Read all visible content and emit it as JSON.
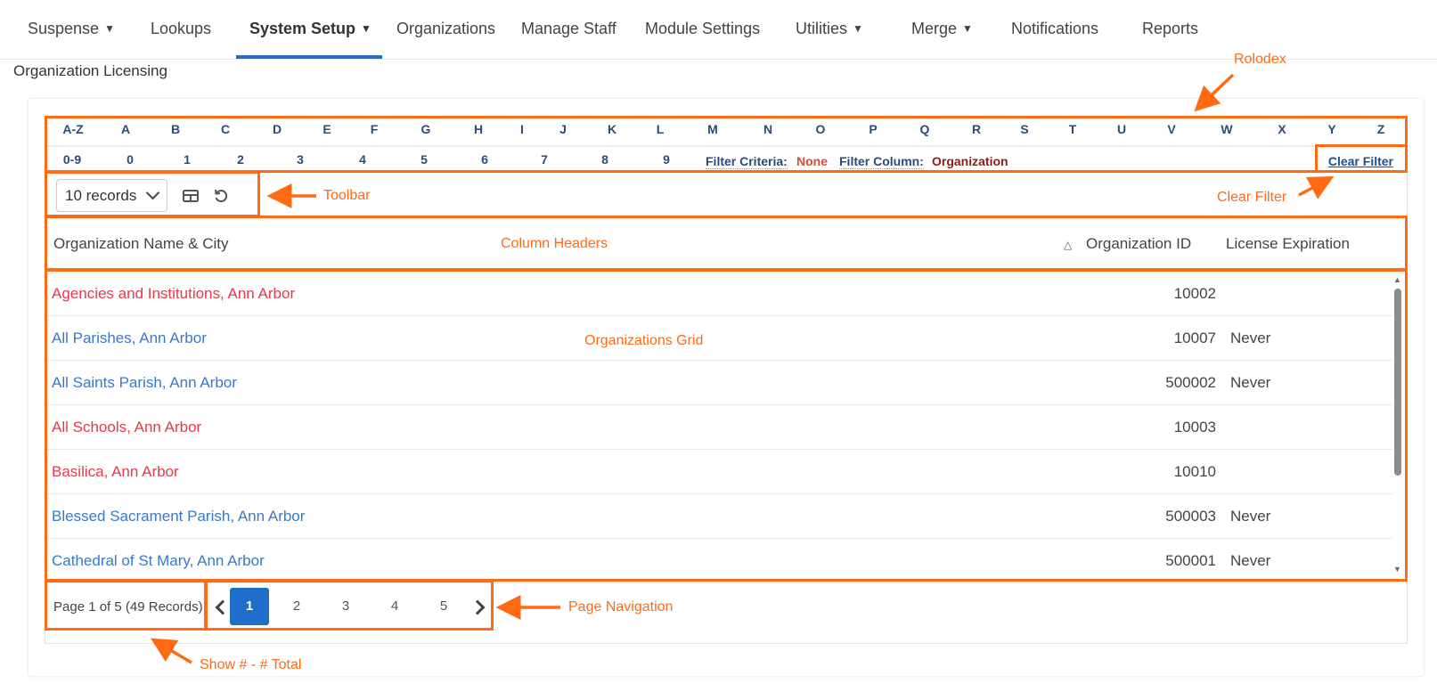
{
  "nav": {
    "items": [
      {
        "label": "Suspense",
        "caret": "▼"
      },
      {
        "label": "Lookups"
      },
      {
        "label": "System Setup",
        "caret": "▼",
        "active": true
      },
      {
        "label": "Organizations"
      },
      {
        "label": "Manage Staff"
      },
      {
        "label": "Module Settings"
      },
      {
        "label": "Utilities",
        "caret": "▼"
      },
      {
        "label": "Merge",
        "caret": "▼"
      },
      {
        "label": "Notifications"
      },
      {
        "label": "Reports"
      }
    ]
  },
  "page_title": "Organization Licensing",
  "rolodex": {
    "letters": [
      "A-Z",
      "A",
      "B",
      "C",
      "D",
      "E",
      "F",
      "G",
      "H",
      "I",
      "J",
      "K",
      "L",
      "M",
      "N",
      "O",
      "P",
      "Q",
      "R",
      "S",
      "T",
      "U",
      "V",
      "W",
      "X",
      "Y",
      "Z"
    ],
    "digits": [
      "0-9",
      "0",
      "1",
      "2",
      "3",
      "4",
      "5",
      "6",
      "7",
      "8",
      "9"
    ],
    "filter_criteria_label": "Filter Criteria:",
    "filter_criteria_value": "None",
    "filter_column_label": "Filter Column:",
    "filter_column_value": "Organization",
    "clear_filter": "Clear Filter"
  },
  "toolbar": {
    "records_select": "10 records",
    "icons": [
      "table-columns-icon",
      "refresh-icon"
    ]
  },
  "columns": {
    "name": "Organization Name & City",
    "sort_icon": "△",
    "id": "Organization ID",
    "expiration": "License Expiration"
  },
  "rows": [
    {
      "name": "Agencies and Institutions, Ann Arbor",
      "id": "10002",
      "expiration": "",
      "color": "#e23b4a"
    },
    {
      "name": "All Parishes, Ann Arbor",
      "id": "10007",
      "expiration": "Never",
      "color": "#3a78c9"
    },
    {
      "name": "All Saints Parish, Ann Arbor",
      "id": "500002",
      "expiration": "Never",
      "color": "#3a78c9"
    },
    {
      "name": "All Schools, Ann Arbor",
      "id": "10003",
      "expiration": "",
      "color": "#e23b4a"
    },
    {
      "name": "Basilica, Ann Arbor",
      "id": "10010",
      "expiration": "",
      "color": "#e23b4a"
    },
    {
      "name": "Blessed Sacrament Parish, Ann Arbor",
      "id": "500003",
      "expiration": "Never",
      "color": "#3a78c9"
    },
    {
      "name": "Cathedral of St Mary, Ann Arbor",
      "id": "500001",
      "expiration": "Never",
      "color": "#3a78c9"
    }
  ],
  "pager": {
    "info": "Page 1 of 5 (49 Records)",
    "pages": [
      "1",
      "2",
      "3",
      "4",
      "5"
    ],
    "current": "1"
  },
  "annotations": {
    "rolodex": "Rolodex",
    "toolbar": "Toolbar",
    "clear_filter": "Clear Filter",
    "column_headers": "Column Headers",
    "organizations_grid": "Organizations Grid",
    "page_navigation": "Page Navigation",
    "show_total": "Show # - # Total"
  },
  "colors": {
    "accent": "#1f6ecc",
    "annotation": "#ff6a13",
    "link_red": "#e23b4a",
    "link_blue": "#3a78c9"
  }
}
